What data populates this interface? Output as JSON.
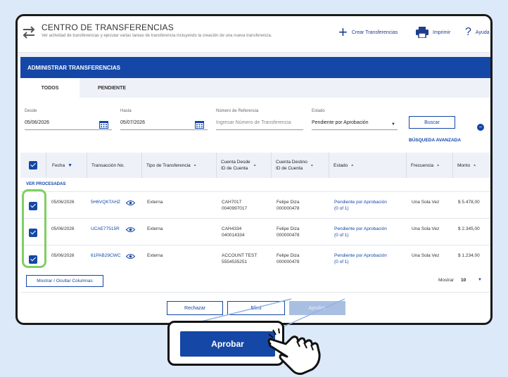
{
  "header": {
    "title": "CENTRO DE TRANSFERENCIAS",
    "subtitle": "Ver actividad de transferencias y ejecutar varias tareas de transferencia incluyendo la creación de una nueva transferencia.",
    "actions": {
      "create": "Crear Transferencias",
      "print": "Imprimir",
      "help": "Ayuda"
    }
  },
  "section_title": "ADMINISTRAR TRANSFERENCIAS",
  "tabs": [
    {
      "label": "TODOS",
      "active": true
    },
    {
      "label": "PENDIENTE",
      "active": false
    }
  ],
  "filters": {
    "from_label": "Desde",
    "from_value": "05/06/2026",
    "to_label": "Hasta",
    "to_value": "05/07/2026",
    "ref_label": "Número de Referencia",
    "ref_placeholder": "Ingresar Número de Transferencia",
    "status_label": "Estado",
    "status_value": "Pendiente por Aprobación",
    "search_button": "Buscar",
    "advanced_search": "BÚSQUEDA AVANZADA"
  },
  "table": {
    "columns": [
      "Fecha",
      "Transacción No.",
      "Tipo de Transferencia",
      "Cuenta Desde",
      "ID de Cuenta",
      "Cuenta Destino",
      "ID de Cuenta",
      "Estado",
      "Frecuencia",
      "Monto"
    ],
    "processed_link": "VER PROCESADAS",
    "rows": [
      {
        "date": "05/06/2026",
        "txn": "5H6VQKTAHZ",
        "type": "Externa",
        "from_name": "CAH7017",
        "from_id": "0040997017",
        "to_name": "Felipe Diza",
        "to_id": "000000478",
        "status": "Pendiente por Aprobación",
        "status_count": "(0 of 1)",
        "frequency": "Una Sola Vez",
        "amount": "$ 5.478,00",
        "checked": true
      },
      {
        "date": "05/06/2026",
        "txn": "UCAE77515R",
        "type": "Externa",
        "from_name": "CAH4334",
        "from_id": "040014334",
        "to_name": "Felipe Diza",
        "to_id": "000000478",
        "status": "Pendiente por Aprobación",
        "status_count": "(0 of 1)",
        "frequency": "Una Sola Vez",
        "amount": "$ 2.345,00",
        "checked": true
      },
      {
        "date": "05/06/2026",
        "txn": "61PAB29CWC",
        "type": "Externa",
        "from_name": "ACCOUNT TEST",
        "from_id": "5554535251",
        "to_name": "Felipe Diza",
        "to_id": "000000478",
        "status": "Pendiente por Aprobación",
        "status_count": "(0 of 1)",
        "frequency": "Una Sola Vez",
        "amount": "$ 1.234,00",
        "checked": true
      }
    ]
  },
  "columns_button": "Mostrar / Ocultar Columnas",
  "pagination": {
    "show_label": "Mostrar",
    "show_value": "10"
  },
  "footer": {
    "reject": "Rechazar",
    "delete": "Elimi",
    "approve": "Aprobar"
  },
  "colors": {
    "primary": "#1447a6",
    "highlight": "#7fcf63",
    "background": "#dce9f8"
  }
}
